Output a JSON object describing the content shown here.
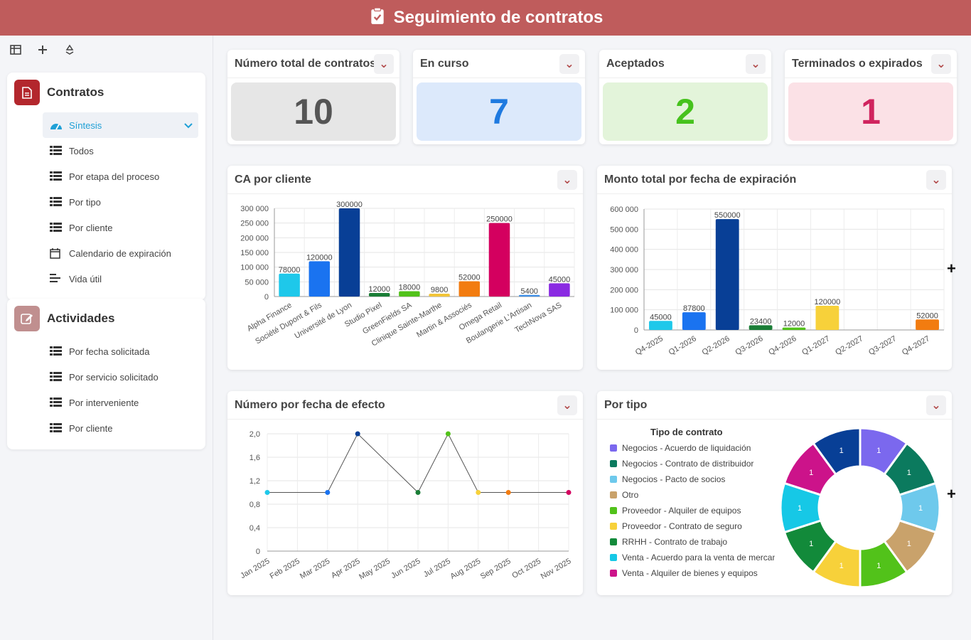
{
  "header": {
    "title": "Seguimiento de contratos"
  },
  "sidebar": {
    "groups": [
      {
        "label": "Contratos",
        "color": "#b3272d",
        "items": [
          {
            "label": "Síntesis",
            "icon": "dashboard-icon",
            "active": true
          },
          {
            "label": "Todos",
            "icon": "table-icon"
          },
          {
            "label": "Por etapa del proceso",
            "icon": "table-icon"
          },
          {
            "label": "Por tipo",
            "icon": "table-icon"
          },
          {
            "label": "Por cliente",
            "icon": "table-icon"
          },
          {
            "label": "Calendario de expiración",
            "icon": "calendar-icon"
          },
          {
            "label": "Vida útil",
            "icon": "gantt-icon"
          }
        ]
      },
      {
        "label": "Actividades",
        "color": "#c08f8f",
        "items": [
          {
            "label": "Por fecha solicitada",
            "icon": "table-icon"
          },
          {
            "label": "Por servicio solicitado",
            "icon": "table-icon"
          },
          {
            "label": "Por interveniente",
            "icon": "table-icon"
          },
          {
            "label": "Por cliente",
            "icon": "table-icon"
          }
        ]
      }
    ]
  },
  "kpis": [
    {
      "title": "Número total de contratos",
      "value": "10",
      "bg": "#e6e6e6",
      "fg": "#555555"
    },
    {
      "title": "En curso",
      "value": "7",
      "bg": "#dce9fb",
      "fg": "#1f7ae0"
    },
    {
      "title": "Aceptados",
      "value": "2",
      "bg": "#e3f4da",
      "fg": "#46c21d"
    },
    {
      "title": "Terminados o expirados",
      "value": "1",
      "bg": "#fbe1e6",
      "fg": "#d0245e"
    }
  ],
  "cards": {
    "ca_cliente": "CA por cliente",
    "monto": "Monto total por fecha de expiración",
    "numero": "Número por fecha de efecto",
    "tipo": "Por tipo"
  },
  "chart_data": [
    {
      "type": "bar",
      "title": "CA por cliente",
      "categories": [
        "Alpha Finance",
        "Société Dupont & Fils",
        "Université de Lyon",
        "Studio Pixel",
        "GreenFields SA",
        "Clinique Sainte-Marthe",
        "Martin & Associés",
        "Omega Retail",
        "Boulangerie L'Artisan",
        "TechNova SAS"
      ],
      "values": [
        78000,
        120000,
        300000,
        12000,
        18000,
        9800,
        52000,
        250000,
        5400,
        45000
      ],
      "colors": [
        "#1ec8ea",
        "#1a73f0",
        "#083f96",
        "#1a7d36",
        "#52c21a",
        "#f2c53a",
        "#f27c10",
        "#d4005f",
        "#3d8ee6",
        "#8a2be2"
      ],
      "ylim": [
        0,
        300000
      ],
      "yticks": [
        "0",
        "50 000",
        "100 000",
        "150 000",
        "200 000",
        "250 000",
        "300 000"
      ]
    },
    {
      "type": "bar",
      "title": "Monto total por fecha de expiración",
      "categories": [
        "Q4-2025",
        "Q1-2026",
        "Q2-2026",
        "Q3-2026",
        "Q4-2026",
        "Q1-2027",
        "Q2-2027",
        "Q3-2027",
        "Q4-2027"
      ],
      "values": [
        45000,
        87800,
        550000,
        23400,
        12000,
        120000,
        0,
        0,
        52000
      ],
      "colors": [
        "#1ec8ea",
        "#1a73f0",
        "#083f96",
        "#1a7d36",
        "#52c21a",
        "#f7d13a",
        "#cccccc",
        "#cccccc",
        "#f27c10"
      ],
      "ylim": [
        0,
        600000
      ],
      "yticks": [
        "0",
        "100 000",
        "200 000",
        "300 000",
        "400 000",
        "500 000",
        "600 000"
      ]
    },
    {
      "type": "line",
      "title": "Número por fecha de efecto",
      "categories": [
        "Jan 2025",
        "Feb 2025",
        "Mar 2025",
        "Apr 2025",
        "May 2025",
        "Jun 2025",
        "Jul 2025",
        "Aug 2025",
        "Sep 2025",
        "Oct 2025",
        "Nov 2025"
      ],
      "points": [
        {
          "x": "Jan 2025",
          "y": 1,
          "color": "#1ec8ea"
        },
        {
          "x": "Mar 2025",
          "y": 1,
          "color": "#1a73f0"
        },
        {
          "x": "Apr 2025",
          "y": 2,
          "color": "#083f96"
        },
        {
          "x": "Jun 2025",
          "y": 1,
          "color": "#1a7d36"
        },
        {
          "x": "Jul 2025",
          "y": 2,
          "color": "#52c21a"
        },
        {
          "x": "Aug 2025",
          "y": 1,
          "color": "#f7d13a"
        },
        {
          "x": "Sep 2025",
          "y": 1,
          "color": "#f27c10"
        },
        {
          "x": "Nov 2025",
          "y": 1,
          "color": "#d4005f"
        }
      ],
      "ylim": [
        0,
        2
      ],
      "yticks": [
        "0",
        "0,4",
        "0,8",
        "1,2",
        "1,6",
        "2,0"
      ]
    },
    {
      "type": "pie",
      "title": "Por tipo",
      "legend_title": "Tipo de contrato",
      "slices": [
        {
          "label": "Negocios - Acuerdo de liquidación",
          "value": 1,
          "color": "#7b68ee"
        },
        {
          "label": "Negocios - Contrato de distribuidor",
          "value": 1,
          "color": "#0b7a5e"
        },
        {
          "label": "Negocios - Pacto de socios",
          "value": 1,
          "color": "#6ec9ec"
        },
        {
          "label": "Otro",
          "value": 1,
          "color": "#c9a26b"
        },
        {
          "label": "Proveedor - Alquiler de equipos",
          "value": 1,
          "color": "#52c21a"
        },
        {
          "label": "Proveedor - Contrato de seguro",
          "value": 1,
          "color": "#f7d13a"
        },
        {
          "label": "RRHH - Contrato de trabajo",
          "value": 1,
          "color": "#128a3a"
        },
        {
          "label": "Venta - Acuerdo para la venta de mercancías",
          "value": 1,
          "color": "#16c8e6"
        },
        {
          "label": "Venta - Alquiler de bienes y equipos",
          "value": 1,
          "color": "#cc138a"
        },
        {
          "label": "",
          "value": 1,
          "color": "#083f96"
        }
      ]
    }
  ]
}
